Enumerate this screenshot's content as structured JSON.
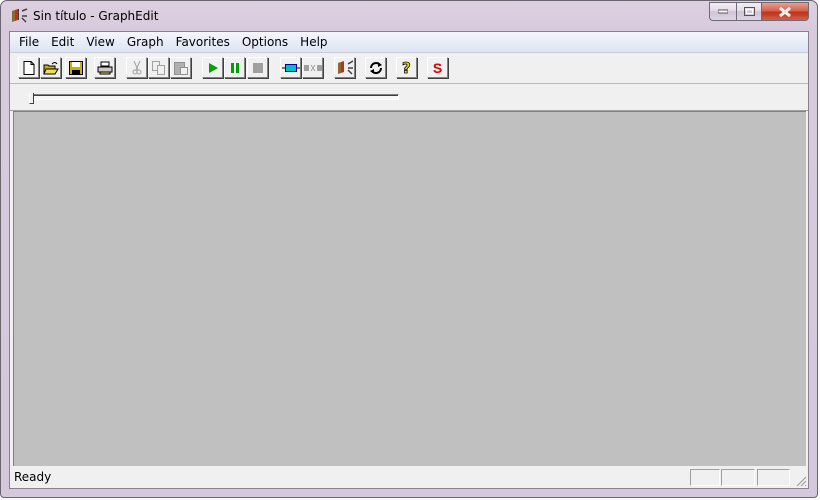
{
  "window": {
    "title": "Sin título - GraphEdit",
    "controls": {
      "minimize": "minimize",
      "maximize": "maximize",
      "close": "close"
    }
  },
  "menu": {
    "items": [
      {
        "label": "File"
      },
      {
        "label": "Edit"
      },
      {
        "label": "View"
      },
      {
        "label": "Graph"
      },
      {
        "label": "Favorites"
      },
      {
        "label": "Options"
      },
      {
        "label": "Help"
      }
    ]
  },
  "toolbar": {
    "buttons": [
      {
        "icon": "new-document-icon",
        "enabled": true
      },
      {
        "icon": "open-folder-icon",
        "enabled": true
      },
      {
        "icon": "save-disk-icon",
        "enabled": true
      },
      {
        "icon": "print-icon",
        "enabled": true
      },
      {
        "icon": "cut-icon",
        "enabled": false
      },
      {
        "icon": "copy-icon",
        "enabled": false
      },
      {
        "icon": "paste-icon",
        "enabled": false
      },
      {
        "icon": "play-icon",
        "enabled": true
      },
      {
        "icon": "pause-icon",
        "enabled": true
      },
      {
        "icon": "stop-icon",
        "enabled": true
      },
      {
        "icon": "insert-filter-icon",
        "enabled": true
      },
      {
        "icon": "disconnect-filter-icon",
        "enabled": false
      },
      {
        "icon": "graphedit-filters-icon",
        "enabled": true
      },
      {
        "icon": "refresh-icon",
        "enabled": true
      },
      {
        "icon": "help-icon",
        "enabled": true
      },
      {
        "icon": "seek-s-icon",
        "enabled": true,
        "label": "S"
      }
    ],
    "colors": {
      "play": "#00a000",
      "s_label": "#e00000",
      "filter": "#00c0c0"
    }
  },
  "seek": {
    "position": 0
  },
  "canvas": {
    "background": "#c0c0c0"
  },
  "status": {
    "text": "Ready"
  }
}
